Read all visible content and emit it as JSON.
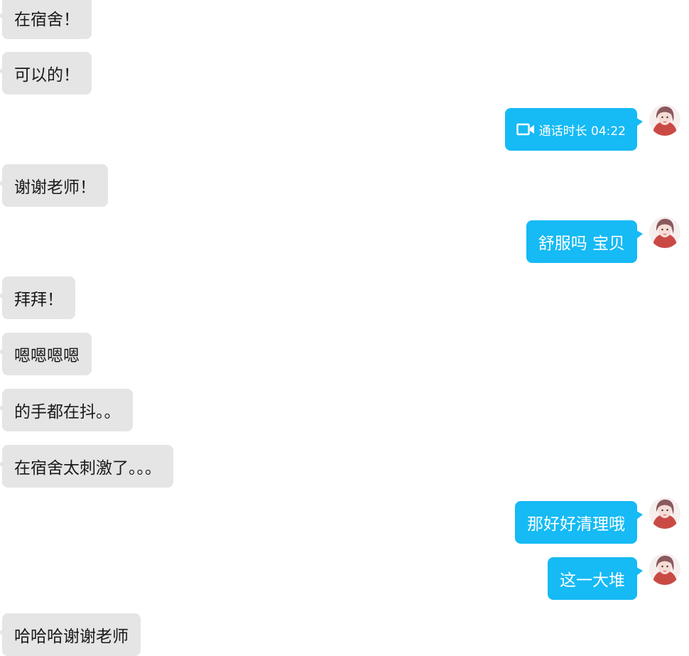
{
  "messages": [
    {
      "side": "in",
      "text": "在宿舍！"
    },
    {
      "side": "in",
      "text": "可以的！"
    },
    {
      "side": "out",
      "type": "call",
      "text": "通话时长 04:22",
      "icon": "video-call-icon"
    },
    {
      "side": "in",
      "text": "谢谢老师！"
    },
    {
      "side": "out",
      "text": "舒服吗 宝贝"
    },
    {
      "side": "in",
      "text": "拜拜！"
    },
    {
      "side": "in",
      "text": "嗯嗯嗯嗯"
    },
    {
      "side": "in",
      "text": "的手都在抖。。"
    },
    {
      "side": "in",
      "text": "在宿舍太刺激了。。。"
    },
    {
      "side": "out",
      "text": "那好好清理哦"
    },
    {
      "side": "out",
      "text": "这一大堆"
    },
    {
      "side": "in",
      "text": "哈哈哈谢谢老师"
    }
  ],
  "colors": {
    "incoming_bubble": "#e5e5e5",
    "outgoing_bubble": "#16baf4",
    "outgoing_text": "#ffffff",
    "incoming_text": "#1a1a1a"
  }
}
